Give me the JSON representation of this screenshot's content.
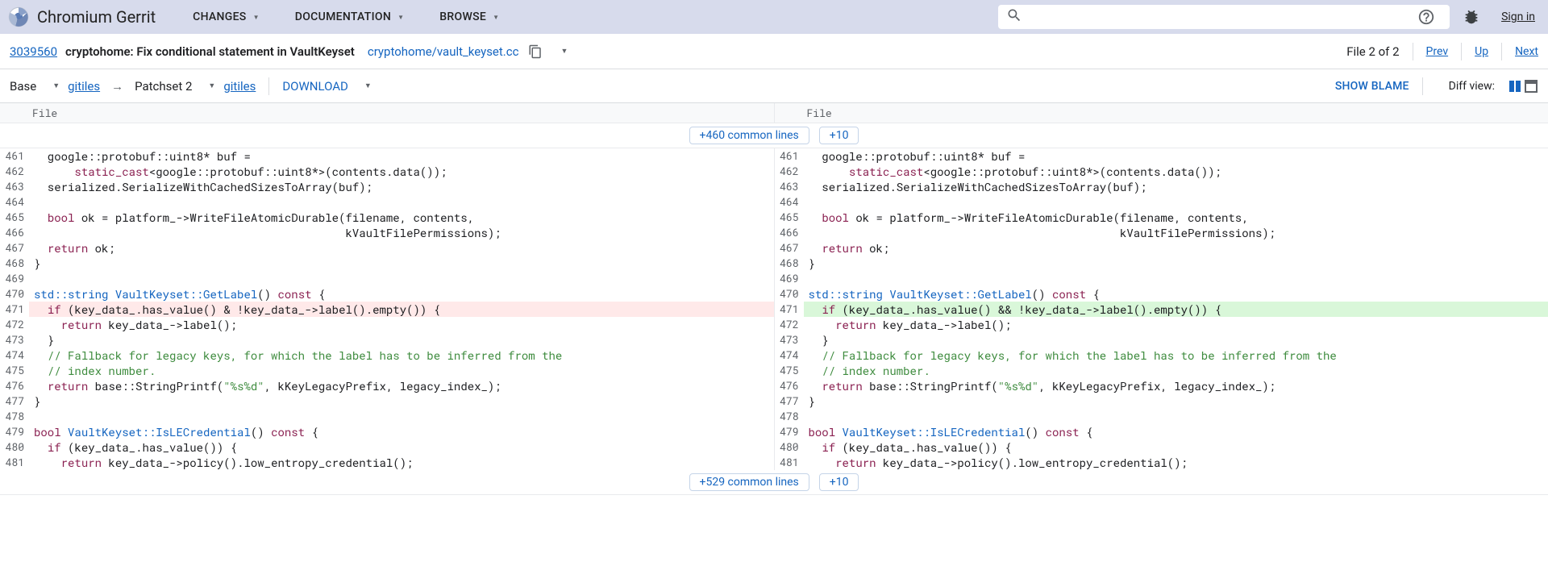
{
  "header": {
    "brand": "Chromium Gerrit",
    "nav": [
      "CHANGES",
      "DOCUMENTATION",
      "BROWSE"
    ],
    "search_placeholder": "",
    "signin": "Sign in"
  },
  "change": {
    "id": "3039560",
    "title": "cryptohome: Fix conditional statement in VaultKeyset",
    "file_path": "cryptohome/vault_keyset.cc",
    "file_counter": "File 2 of 2",
    "prev": "Prev",
    "up": "Up",
    "next": "Next"
  },
  "patchset": {
    "base": "Base",
    "base_link": "gitiles",
    "patchset": "Patchset 2",
    "patchset_link": "gitiles",
    "download": "DOWNLOAD",
    "show_blame": "SHOW BLAME",
    "diff_view": "Diff view:"
  },
  "file_header_left": "File",
  "file_header_right": "File",
  "context_top": {
    "a": "+460 common lines",
    "b": "+10"
  },
  "context_bottom": {
    "a": "+529 common lines",
    "b": "+10"
  },
  "lines_left": [
    {
      "n": 461,
      "t": "plain",
      "segs": [
        [
          "txt",
          "  google::protobuf::uint8* buf ="
        ]
      ]
    },
    {
      "n": 462,
      "t": "plain",
      "segs": [
        [
          "txt",
          "      "
        ],
        [
          "kw",
          "static_cast"
        ],
        [
          "txt",
          "<google::protobuf::uint8*>(contents.data());"
        ]
      ]
    },
    {
      "n": 463,
      "t": "plain",
      "segs": [
        [
          "txt",
          "  serialized.SerializeWithCachedSizesToArray(buf);"
        ]
      ]
    },
    {
      "n": 464,
      "t": "plain",
      "segs": [
        [
          "txt",
          ""
        ]
      ]
    },
    {
      "n": 465,
      "t": "plain",
      "segs": [
        [
          "txt",
          "  "
        ],
        [
          "kw",
          "bool"
        ],
        [
          "txt",
          " ok = platform_->WriteFileAtomicDurable(filename, contents,"
        ]
      ]
    },
    {
      "n": 466,
      "t": "plain",
      "segs": [
        [
          "txt",
          "                                              kVaultFilePermissions);"
        ]
      ]
    },
    {
      "n": 467,
      "t": "plain",
      "segs": [
        [
          "txt",
          "  "
        ],
        [
          "kw",
          "return"
        ],
        [
          "txt",
          " ok;"
        ]
      ]
    },
    {
      "n": 468,
      "t": "plain",
      "segs": [
        [
          "txt",
          "}"
        ]
      ]
    },
    {
      "n": 469,
      "t": "plain",
      "segs": [
        [
          "txt",
          ""
        ]
      ]
    },
    {
      "n": 470,
      "t": "plain",
      "segs": [
        [
          "type",
          "std::string"
        ],
        [
          "txt",
          " "
        ],
        [
          "fn",
          "VaultKeyset::GetLabel"
        ],
        [
          "txt",
          "() "
        ],
        [
          "kw",
          "const"
        ],
        [
          "txt",
          " {"
        ]
      ]
    },
    {
      "n": 471,
      "t": "removed",
      "segs": [
        [
          "txt",
          "  "
        ],
        [
          "kw",
          "if"
        ],
        [
          "txt",
          " (key_data_.has_value() & !key_data_->label().empty()) {"
        ]
      ]
    },
    {
      "n": 472,
      "t": "plain",
      "segs": [
        [
          "txt",
          "    "
        ],
        [
          "kw",
          "return"
        ],
        [
          "txt",
          " key_data_->label();"
        ]
      ]
    },
    {
      "n": 473,
      "t": "plain",
      "segs": [
        [
          "txt",
          "  }"
        ]
      ]
    },
    {
      "n": 474,
      "t": "plain",
      "segs": [
        [
          "txt",
          "  "
        ],
        [
          "cm",
          "// Fallback for legacy keys, for which the label has to be inferred from the"
        ]
      ]
    },
    {
      "n": 475,
      "t": "plain",
      "segs": [
        [
          "txt",
          "  "
        ],
        [
          "cm",
          "// index number."
        ]
      ]
    },
    {
      "n": 476,
      "t": "plain",
      "segs": [
        [
          "txt",
          "  "
        ],
        [
          "kw",
          "return"
        ],
        [
          "txt",
          " base::StringPrintf("
        ],
        [
          "str",
          "\"%s%d\""
        ],
        [
          "txt",
          ", kKeyLegacyPrefix, legacy_index_);"
        ]
      ]
    },
    {
      "n": 477,
      "t": "plain",
      "segs": [
        [
          "txt",
          "}"
        ]
      ]
    },
    {
      "n": 478,
      "t": "plain",
      "segs": [
        [
          "txt",
          ""
        ]
      ]
    },
    {
      "n": 479,
      "t": "plain",
      "segs": [
        [
          "kw",
          "bool"
        ],
        [
          "txt",
          " "
        ],
        [
          "fn",
          "VaultKeyset::IsLECredential"
        ],
        [
          "txt",
          "() "
        ],
        [
          "kw",
          "const"
        ],
        [
          "txt",
          " {"
        ]
      ]
    },
    {
      "n": 480,
      "t": "plain",
      "segs": [
        [
          "txt",
          "  "
        ],
        [
          "kw",
          "if"
        ],
        [
          "txt",
          " (key_data_.has_value()) {"
        ]
      ]
    },
    {
      "n": 481,
      "t": "plain",
      "segs": [
        [
          "txt",
          "    "
        ],
        [
          "kw",
          "return"
        ],
        [
          "txt",
          " key_data_->policy().low_entropy_credential();"
        ]
      ]
    }
  ],
  "lines_right": [
    {
      "n": 461,
      "t": "plain",
      "segs": [
        [
          "txt",
          "  google::protobuf::uint8* buf ="
        ]
      ]
    },
    {
      "n": 462,
      "t": "plain",
      "segs": [
        [
          "txt",
          "      "
        ],
        [
          "kw",
          "static_cast"
        ],
        [
          "txt",
          "<google::protobuf::uint8*>(contents.data());"
        ]
      ]
    },
    {
      "n": 463,
      "t": "plain",
      "segs": [
        [
          "txt",
          "  serialized.SerializeWithCachedSizesToArray(buf);"
        ]
      ]
    },
    {
      "n": 464,
      "t": "plain",
      "segs": [
        [
          "txt",
          ""
        ]
      ]
    },
    {
      "n": 465,
      "t": "plain",
      "segs": [
        [
          "txt",
          "  "
        ],
        [
          "kw",
          "bool"
        ],
        [
          "txt",
          " ok = platform_->WriteFileAtomicDurable(filename, contents,"
        ]
      ]
    },
    {
      "n": 466,
      "t": "plain",
      "segs": [
        [
          "txt",
          "                                              kVaultFilePermissions);"
        ]
      ]
    },
    {
      "n": 467,
      "t": "plain",
      "segs": [
        [
          "txt",
          "  "
        ],
        [
          "kw",
          "return"
        ],
        [
          "txt",
          " ok;"
        ]
      ]
    },
    {
      "n": 468,
      "t": "plain",
      "segs": [
        [
          "txt",
          "}"
        ]
      ]
    },
    {
      "n": 469,
      "t": "plain",
      "segs": [
        [
          "txt",
          ""
        ]
      ]
    },
    {
      "n": 470,
      "t": "plain",
      "segs": [
        [
          "type",
          "std::string"
        ],
        [
          "txt",
          " "
        ],
        [
          "fn",
          "VaultKeyset::GetLabel"
        ],
        [
          "txt",
          "() "
        ],
        [
          "kw",
          "const"
        ],
        [
          "txt",
          " {"
        ]
      ]
    },
    {
      "n": 471,
      "t": "added",
      "segs": [
        [
          "txt",
          "  "
        ],
        [
          "kw",
          "if"
        ],
        [
          "txt",
          " (key_data_.has_value() && !key_data_->label().empty()) {"
        ]
      ]
    },
    {
      "n": 472,
      "t": "plain",
      "segs": [
        [
          "txt",
          "    "
        ],
        [
          "kw",
          "return"
        ],
        [
          "txt",
          " key_data_->label();"
        ]
      ]
    },
    {
      "n": 473,
      "t": "plain",
      "segs": [
        [
          "txt",
          "  }"
        ]
      ]
    },
    {
      "n": 474,
      "t": "plain",
      "segs": [
        [
          "txt",
          "  "
        ],
        [
          "cm",
          "// Fallback for legacy keys, for which the label has to be inferred from the"
        ]
      ]
    },
    {
      "n": 475,
      "t": "plain",
      "segs": [
        [
          "txt",
          "  "
        ],
        [
          "cm",
          "// index number."
        ]
      ]
    },
    {
      "n": 476,
      "t": "plain",
      "segs": [
        [
          "txt",
          "  "
        ],
        [
          "kw",
          "return"
        ],
        [
          "txt",
          " base::StringPrintf("
        ],
        [
          "str",
          "\"%s%d\""
        ],
        [
          "txt",
          ", kKeyLegacyPrefix, legacy_index_);"
        ]
      ]
    },
    {
      "n": 477,
      "t": "plain",
      "segs": [
        [
          "txt",
          "}"
        ]
      ]
    },
    {
      "n": 478,
      "t": "plain",
      "segs": [
        [
          "txt",
          ""
        ]
      ]
    },
    {
      "n": 479,
      "t": "plain",
      "segs": [
        [
          "kw",
          "bool"
        ],
        [
          "txt",
          " "
        ],
        [
          "fn",
          "VaultKeyset::IsLECredential"
        ],
        [
          "txt",
          "() "
        ],
        [
          "kw",
          "const"
        ],
        [
          "txt",
          " {"
        ]
      ]
    },
    {
      "n": 480,
      "t": "plain",
      "segs": [
        [
          "txt",
          "  "
        ],
        [
          "kw",
          "if"
        ],
        [
          "txt",
          " (key_data_.has_value()) {"
        ]
      ]
    },
    {
      "n": 481,
      "t": "plain",
      "segs": [
        [
          "txt",
          "    "
        ],
        [
          "kw",
          "return"
        ],
        [
          "txt",
          " key_data_->policy().low_entropy_credential();"
        ]
      ]
    }
  ]
}
